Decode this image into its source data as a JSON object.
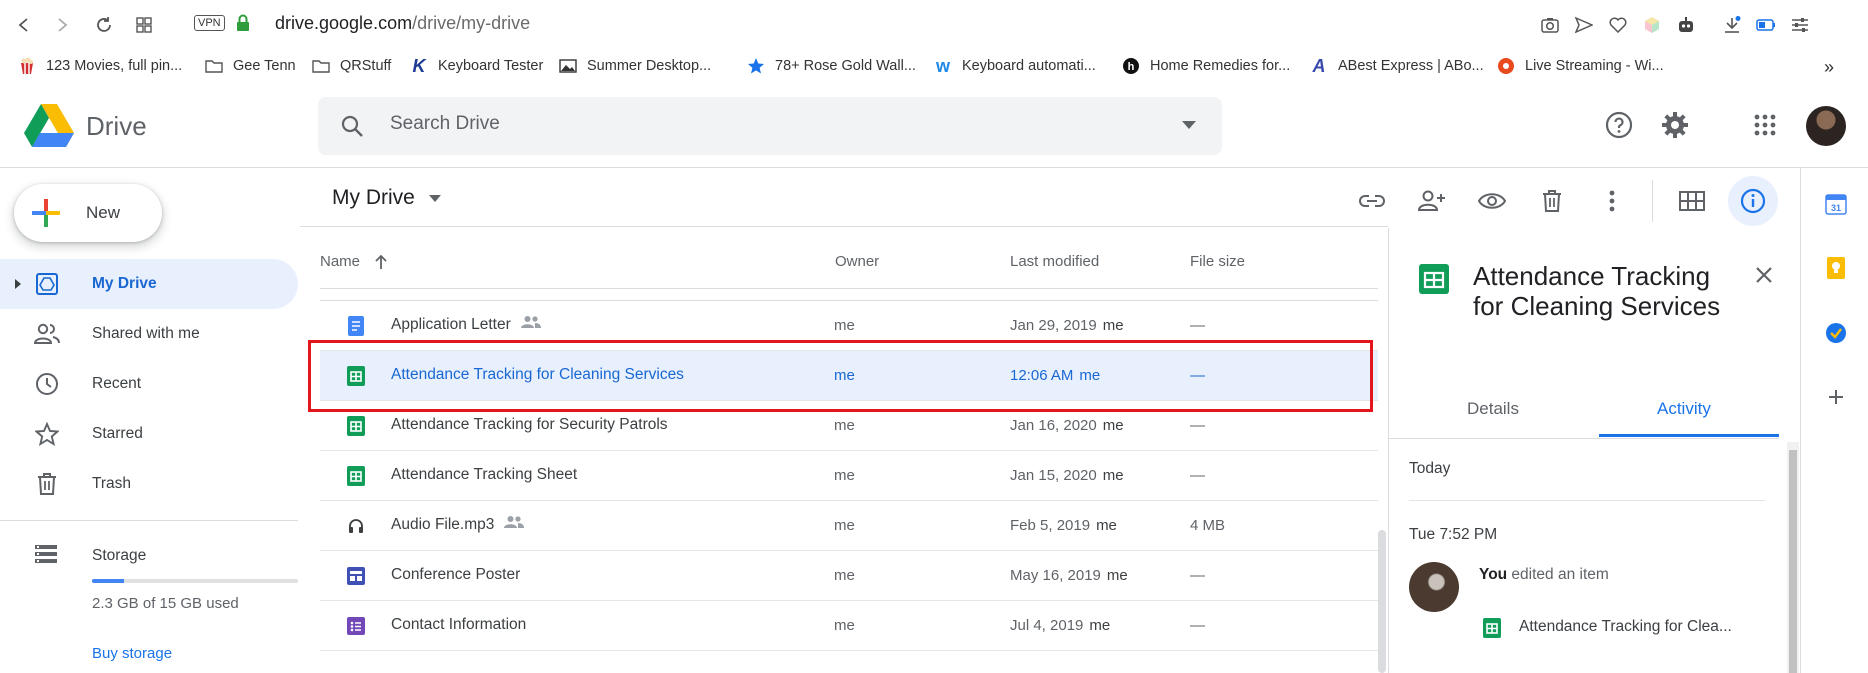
{
  "browser": {
    "vpn_label": "VPN",
    "url_host": "drive.google.com",
    "url_path": "/drive/my-drive",
    "bookmarks": [
      {
        "label": "123 Movies, full pin...",
        "icon": "popcorn-icon"
      },
      {
        "label": "Gee Tenn",
        "icon": "folder-icon"
      },
      {
        "label": "QRStuff",
        "icon": "folder-icon"
      },
      {
        "label": "Keyboard Tester",
        "icon": "k-logo-icon"
      },
      {
        "label": "Summer Desktop...",
        "icon": "image-icon"
      },
      {
        "label": "78+ Rose Gold Wall...",
        "icon": "star-icon"
      },
      {
        "label": "Keyboard automati...",
        "icon": "w-logo-icon"
      },
      {
        "label": "Home Remedies for...",
        "icon": "h-logo-icon"
      },
      {
        "label": "ABest Express | ABo...",
        "icon": "a-logo-icon"
      },
      {
        "label": "Live Streaming - Wi...",
        "icon": "stream-logo-icon"
      }
    ],
    "more_bookmarks": "»"
  },
  "drive": {
    "logo_text": "Drive",
    "search_placeholder": "Search Drive"
  },
  "sidebar": {
    "new_label": "New",
    "items": [
      {
        "label": "My Drive",
        "icon": "my-drive-icon",
        "active": true
      },
      {
        "label": "Shared with me",
        "icon": "shared-icon"
      },
      {
        "label": "Recent",
        "icon": "clock-icon"
      },
      {
        "label": "Starred",
        "icon": "star-outline-icon"
      },
      {
        "label": "Trash",
        "icon": "trash-icon"
      }
    ],
    "storage_label": "Storage",
    "storage_used": "2.3 GB of 15 GB used",
    "storage_fraction": 0.153,
    "buy_storage": "Buy storage"
  },
  "main": {
    "breadcrumb": "My Drive",
    "columns": {
      "name": "Name",
      "owner": "Owner",
      "modified": "Last modified",
      "size": "File size"
    },
    "files": [
      {
        "name": "Application Letter",
        "type": "doc",
        "shared": true,
        "owner": "me",
        "modified": "Jan 29, 2019",
        "by": "me",
        "size": "—"
      },
      {
        "name": "Attendance Tracking for Cleaning Services",
        "type": "sheet",
        "shared": false,
        "owner": "me",
        "modified": "12:06 AM",
        "by": "me",
        "size": "—",
        "selected": true
      },
      {
        "name": "Attendance Tracking for Security Patrols",
        "type": "sheet",
        "shared": false,
        "owner": "me",
        "modified": "Jan 16, 2020",
        "by": "me",
        "size": "—"
      },
      {
        "name": "Attendance Tracking Sheet",
        "type": "sheet",
        "shared": false,
        "owner": "me",
        "modified": "Jan 15, 2020",
        "by": "me",
        "size": "—"
      },
      {
        "name": "Audio File.mp3",
        "type": "audio",
        "shared": true,
        "owner": "me",
        "modified": "Feb 5, 2019",
        "by": "me",
        "size": "4 MB"
      },
      {
        "name": "Conference Poster",
        "type": "site",
        "shared": false,
        "owner": "me",
        "modified": "May 16, 2019",
        "by": "me",
        "size": "—"
      },
      {
        "name": "Contact Information",
        "type": "form",
        "shared": false,
        "owner": "me",
        "modified": "Jul 4, 2019",
        "by": "me",
        "size": "—"
      }
    ]
  },
  "details": {
    "title": "Attendance Tracking for Cleaning Services",
    "tab_details": "Details",
    "tab_activity": "Activity",
    "section_today": "Today",
    "time": "Tue 7:52 PM",
    "actor": "You",
    "action": " edited an item",
    "file": "Attendance Tracking for Clea..."
  },
  "colors": {
    "accent": "#1a73e8",
    "selected_bg": "#e8f0fe",
    "sheet_green": "#0f9d58",
    "highlight_red": "#e3161d"
  }
}
